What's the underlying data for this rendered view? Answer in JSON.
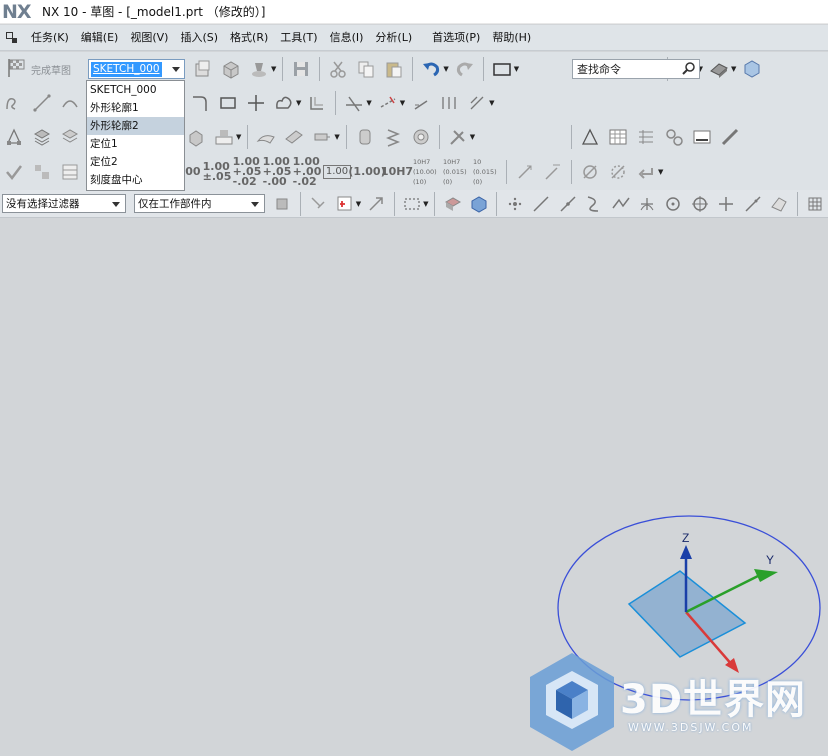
{
  "app": {
    "logo": "NX",
    "title": "NX 10 - 草图 - [_model1.prt （修改的）]"
  },
  "menu": {
    "items": [
      "任务(K)",
      "编辑(E)",
      "视图(V)",
      "插入(S)",
      "格式(R)",
      "工具(T)",
      "信息(I)",
      "分析(L)",
      "首选项(P)",
      "帮助(H)"
    ]
  },
  "toolbar": {
    "finish_sketch_label": "完成草图",
    "sketch_name_value": "SKETCH_000",
    "find_command_placeholder": "查找命令"
  },
  "sketch_dropdown": {
    "options": [
      "SKETCH_000",
      "外形轮廓1",
      "外形轮廓2",
      "定位1",
      "定位2",
      "刻度盘中心"
    ],
    "selected": "外形轮廓2"
  },
  "dimension_tools": {
    "labels": [
      "1.00",
      "1.00 ±.05",
      "1.00 +.05 -.02",
      "1.00 +.05 -.00",
      "1.00 +.00 -.02",
      "1.00",
      "(1.00)",
      "10H7",
      "10H7 (10.00) (10)",
      "10H7 (0.015) (0)",
      "10 (0.015) (0)"
    ]
  },
  "selection_bar": {
    "filter_value": "没有选择过滤器",
    "scope_value": "仅在工作部件内"
  },
  "viewport": {
    "axis_labels": {
      "x": "",
      "y": "Y",
      "z": "Z"
    },
    "colors": {
      "x_axis": "#d93a3a",
      "y_axis": "#2aa02a",
      "z_axis": "#1a3fa8",
      "circle": "#3a4fd8",
      "plane": "#7ea6cf"
    }
  },
  "watermark": {
    "text": "3D世界网",
    "url": "WWW.3DSJW.COM"
  },
  "icons": [
    "flag-icon",
    "menu-grid-icon",
    "search-icon",
    "save-icon",
    "undo-icon",
    "redo-icon",
    "rectangle-icon",
    "fit-view-icon",
    "shaded-view-icon"
  ]
}
